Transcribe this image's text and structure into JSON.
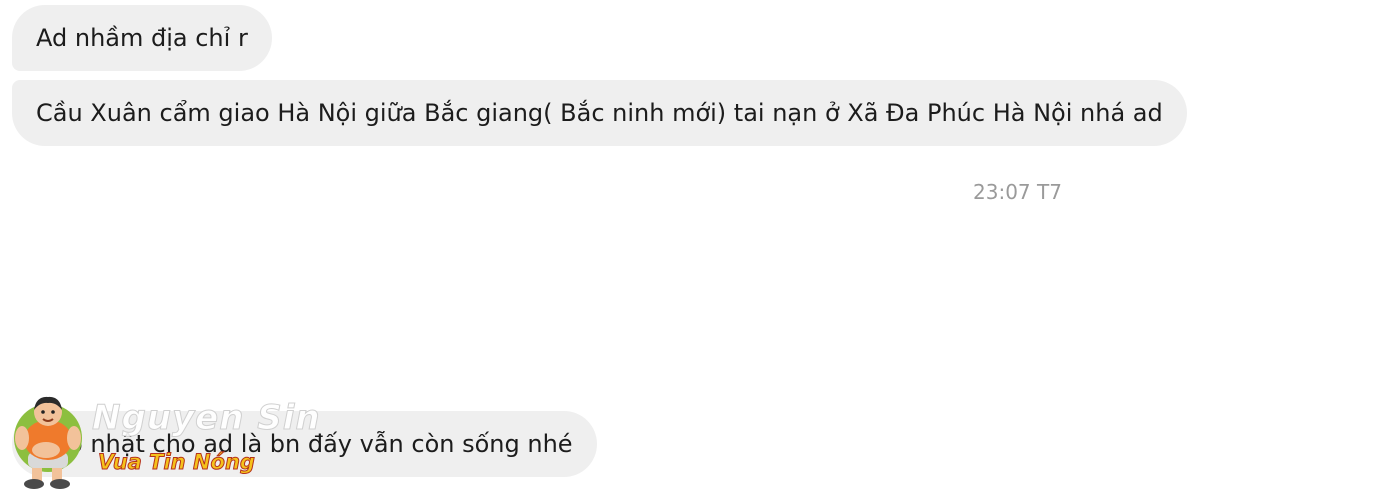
{
  "messages": [
    {
      "text": "Ad nhầm địa chỉ r"
    },
    {
      "text": "Cầu Xuân cẩm giao Hà Nội giữa Bắc giang( Bắc ninh mới) tai nạn ở Xã Đa Phúc Hà Nội nhá ad"
    },
    {
      "text": "Cập nhật cho ad là bn đấy vẫn còn sống nhé"
    }
  ],
  "timestamp": "23:07 T7",
  "watermark": {
    "name": "Nguyen Sin",
    "tagline": "Vua Tin Nóng"
  }
}
